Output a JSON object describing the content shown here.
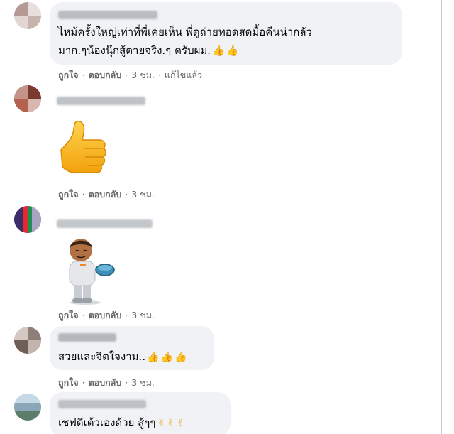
{
  "comments": [
    {
      "text_line1": "ไหม้ครั้งใหญ่เท่าที่พี่เคยเห็น พี่ดูถ่ายทอดสดมื้อคืนน่ากลัว",
      "text_line2": "มาก.ๆน้องนุ๊กสู้ตายจริง.ๆ ครับผม.",
      "emojis": [
        "👍",
        "👍"
      ],
      "actions": {
        "like": "ถูกใจ",
        "reply": "ตอบกลับ",
        "time": "3 ชม.",
        "edited": "แก้ไขแล้ว"
      }
    },
    {
      "sticker": "thumbs-up-sticker",
      "actions": {
        "like": "ถูกใจ",
        "reply": "ตอบกลับ",
        "time": "3 ชม."
      }
    },
    {
      "sticker": "chef-sticker",
      "actions": {
        "like": "ถูกใจ",
        "reply": "ตอบกลับ",
        "time": "3 ชม."
      }
    },
    {
      "text_line1": "สวยและจิตใจงาม..",
      "emojis": [
        "👍",
        "👍",
        "👍"
      ],
      "actions": {
        "like": "ถูกใจ",
        "reply": "ตอบกลับ",
        "time": "3 ชม."
      }
    },
    {
      "text_line1": "เชฟดีเต้วเองด้วย สู้ๆๆ",
      "emojis": [
        "✌",
        "✌",
        "✌"
      ]
    }
  ],
  "separator": "·",
  "colors": {
    "bubble": "#f0f2f5",
    "meta": "#65676b",
    "text": "#050505",
    "emoji": "#f7b125"
  }
}
